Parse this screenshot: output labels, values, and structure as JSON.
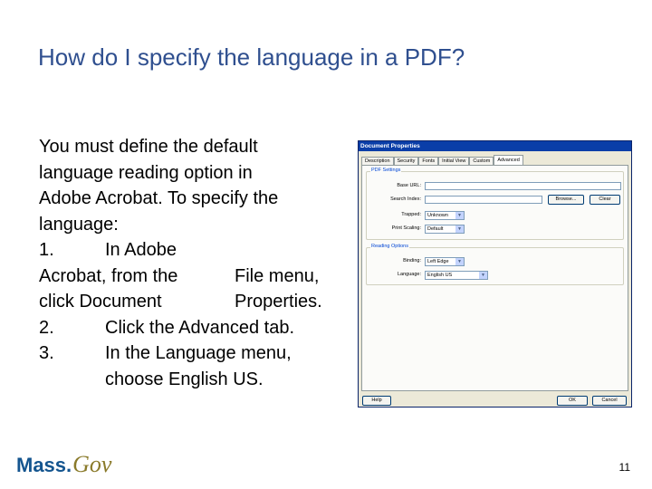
{
  "slide": {
    "title": "How do I specify the language in a PDF?",
    "intro": [
      "You must define the default",
      "language reading option in",
      "Adobe Acrobat.  To specify the",
      "language:"
    ],
    "steps": [
      {
        "num": "1.",
        "line1": "In Adobe",
        "line2a": "Acrobat, from the",
        "line2b": "File menu,",
        "line3a": "click Document",
        "line3b": "Properties."
      },
      {
        "num": "2.",
        "text": "Click the Advanced tab."
      },
      {
        "num": "3.",
        "text": "In the Language menu,",
        "text2": "choose English US."
      }
    ],
    "page_number": "11"
  },
  "logo": {
    "part1": "Mass.",
    "part2": "Gov"
  },
  "dialog": {
    "title": "Document Properties",
    "tabs": [
      "Description",
      "Security",
      "Fonts",
      "Initial View",
      "Custom",
      "Advanced"
    ],
    "active_tab": "Advanced",
    "pdf_settings": {
      "legend": "PDF Settings",
      "base_url_label": "Base URL:",
      "base_url_value": "",
      "search_index_label": "Search Index:",
      "search_index_value": "",
      "browse_button": "Browse...",
      "clear_button": "Clear",
      "trapped_label": "Trapped:",
      "trapped_value": "Unknown",
      "print_scaling_label": "Print Scaling:",
      "print_scaling_value": "Default"
    },
    "reading_options": {
      "legend": "Reading Options",
      "binding_label": "Binding:",
      "binding_value": "Left Edge",
      "language_label": "Language:",
      "language_value": "English US"
    },
    "help_button": "Help",
    "ok_button": "OK",
    "cancel_button": "Cancel"
  }
}
